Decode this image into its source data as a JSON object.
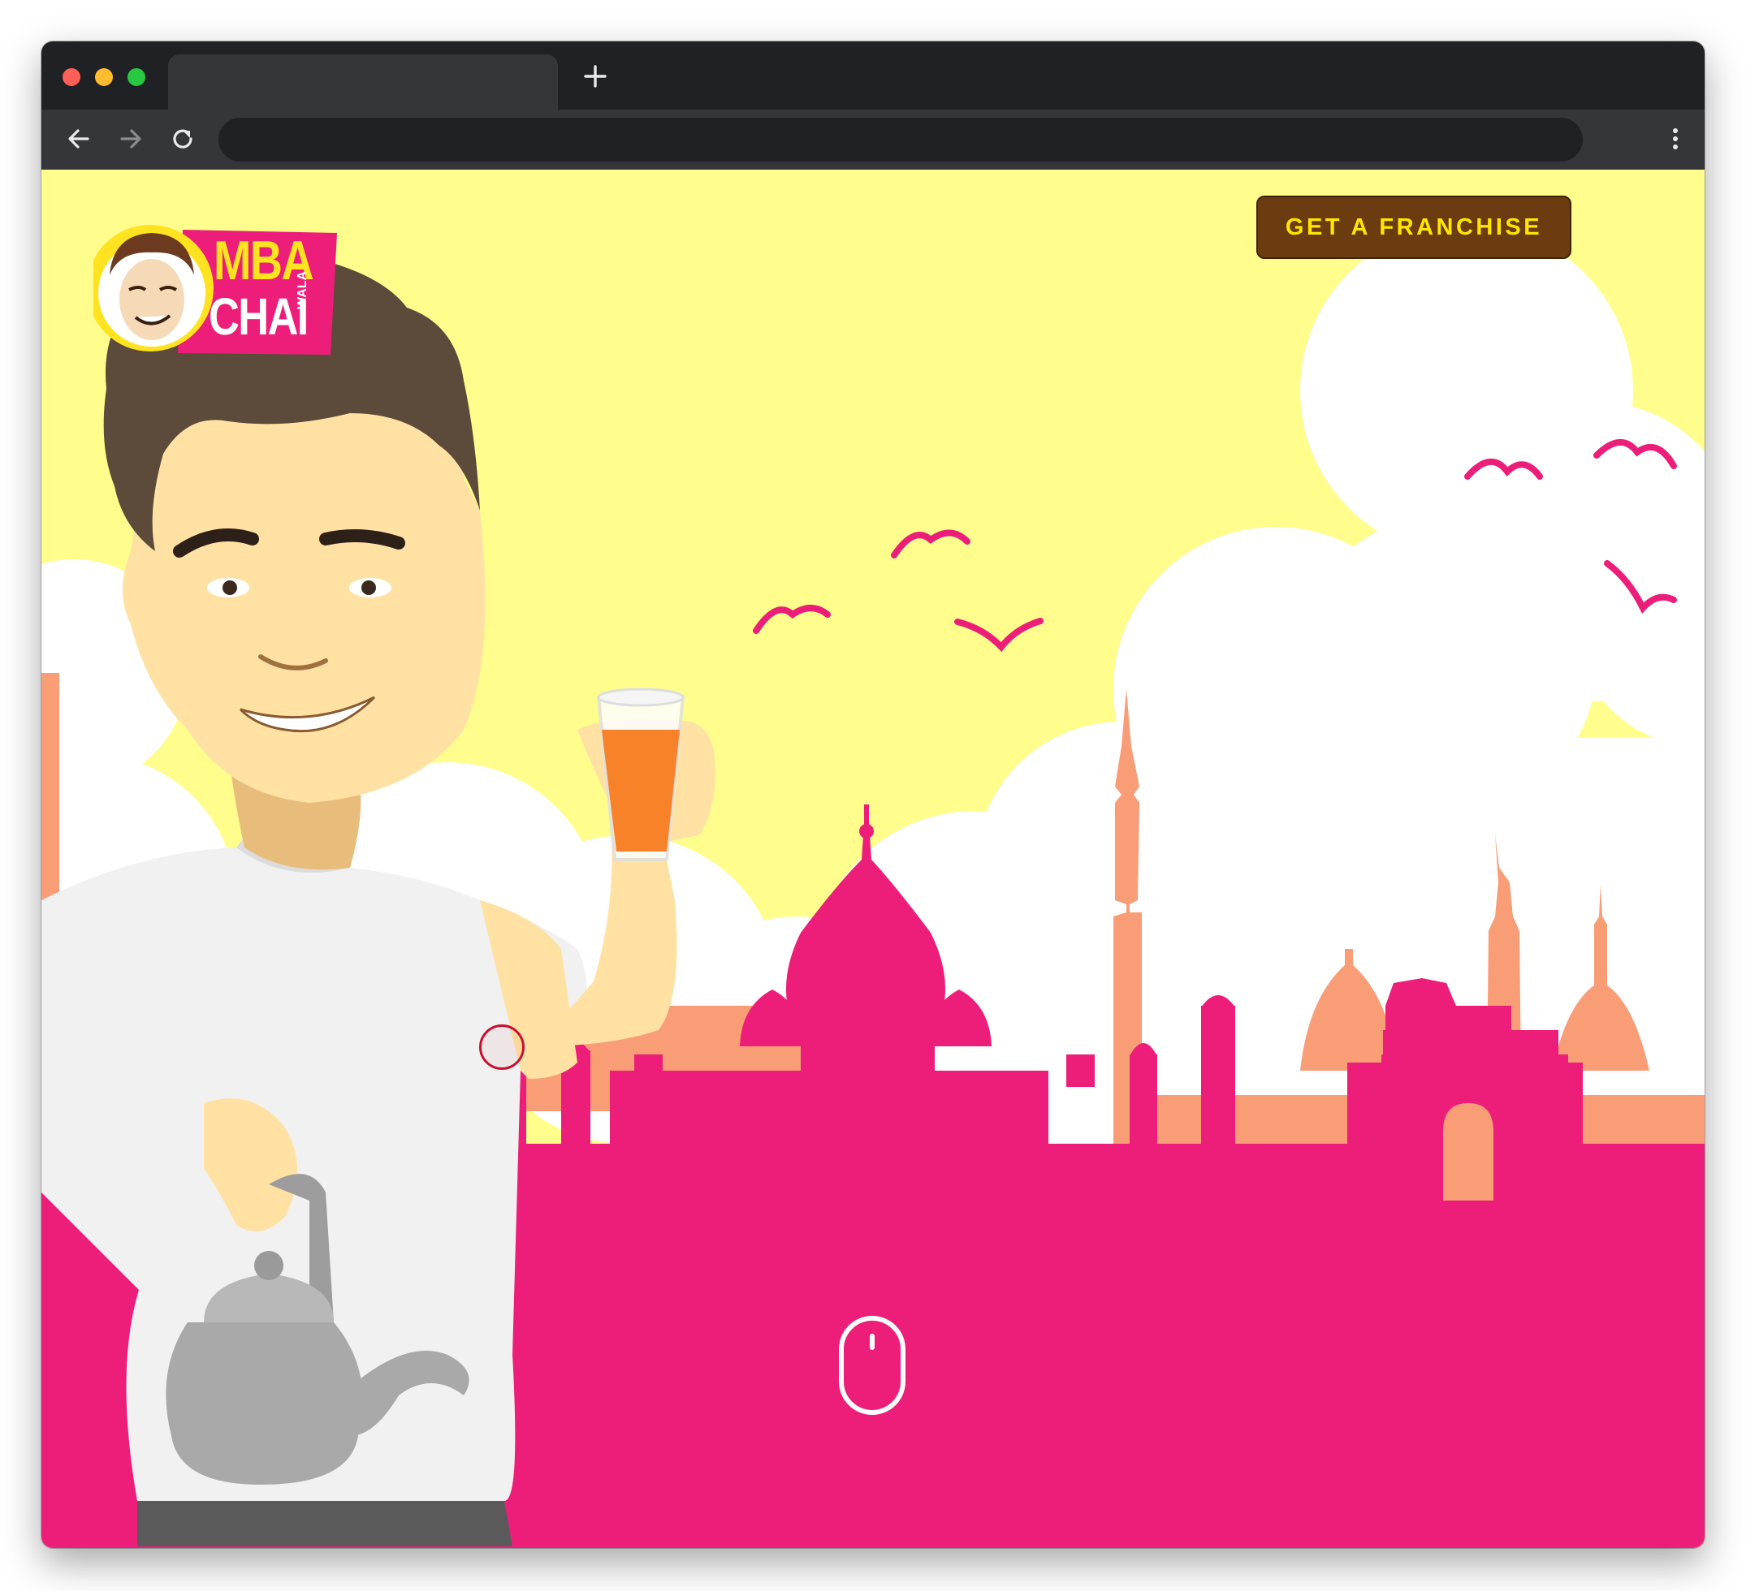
{
  "browser": {
    "tab_title": "",
    "address": "",
    "new_tab_icon": "plus-icon",
    "back_icon": "arrow-left-icon",
    "forward_icon": "arrow-right-icon",
    "reload_icon": "reload-icon",
    "menu_icon": "more-vertical-icon"
  },
  "site": {
    "logo": {
      "line1": "MBA",
      "line2": "CHAI",
      "line3": "WALA"
    },
    "cta_label": "GET A FRANCHISE",
    "scroll_hint_icon": "mouse-scroll-icon"
  },
  "colors": {
    "sky": "#fffe8c",
    "skyline_magenta": "#ec1e79",
    "skyline_peach": "#f99d77",
    "cta_bg": "#6b3c10",
    "cta_text": "#ffe600"
  }
}
